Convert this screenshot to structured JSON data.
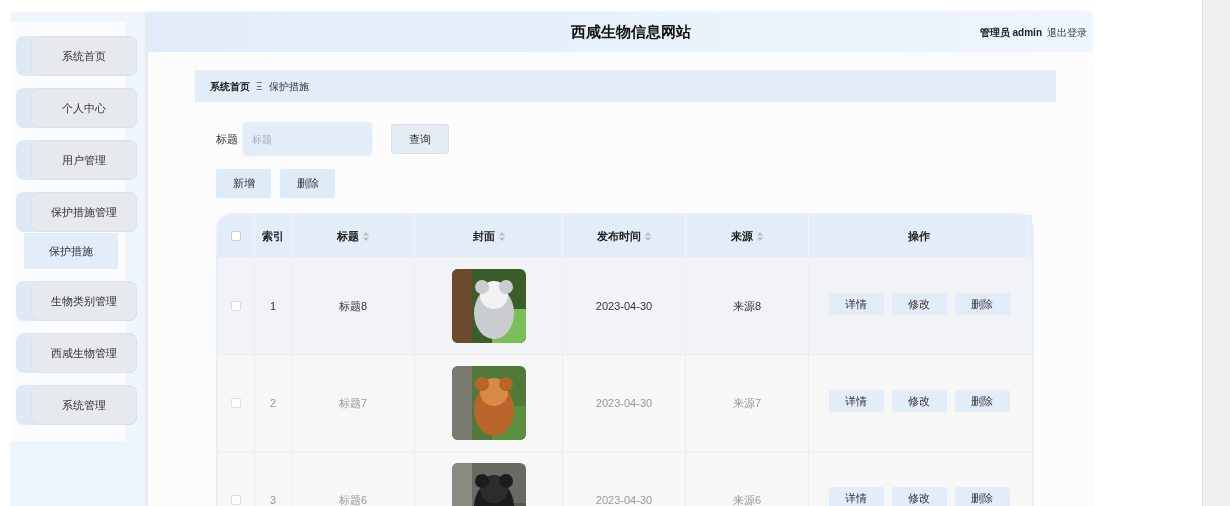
{
  "site_title": "西咸生物信息网站",
  "user": {
    "role": "管理员 admin",
    "logout": "退出登录"
  },
  "sidebar": {
    "items": [
      {
        "label": "系统首页"
      },
      {
        "label": "个人中心"
      },
      {
        "label": "用户管理"
      },
      {
        "label": "保护措施管理",
        "children": [
          {
            "label": "保护措施",
            "selected": true
          }
        ]
      },
      {
        "label": "生物类别管理"
      },
      {
        "label": "西咸生物管理"
      },
      {
        "label": "系统管理"
      }
    ]
  },
  "breadcrumb": {
    "home": "系统首页",
    "separator": "Ξ",
    "current": "保护措施"
  },
  "search": {
    "label": "标题",
    "placeholder": "标题",
    "button": "查询"
  },
  "actions": [
    "新增",
    "删除"
  ],
  "table": {
    "all_checked": false,
    "columns": [
      {
        "label": "索引",
        "sortable": false
      },
      {
        "label": "标题",
        "sortable": true
      },
      {
        "label": "封面",
        "sortable": true
      },
      {
        "label": "发布时间",
        "sortable": true
      },
      {
        "label": "来源",
        "sortable": true
      },
      {
        "label": "操作",
        "sortable": false
      }
    ],
    "rows": [
      {
        "index": "1",
        "title": "标题8",
        "date": "2023-04-30",
        "source": "来源8",
        "hovered": true,
        "checked": false,
        "buttons": [
          "详情",
          "修改",
          "删除"
        ]
      },
      {
        "index": "2",
        "title": "标题7",
        "date": "2023-04-30",
        "source": "来源7",
        "hovered": false,
        "checked": false,
        "buttons": [
          "详情",
          "修改",
          "删除"
        ]
      },
      {
        "index": "3",
        "title": "标题6",
        "date": "2023-04-30",
        "source": "来源6",
        "hovered": false,
        "checked": false,
        "buttons": [
          "详情",
          "修改",
          "删除"
        ]
      }
    ]
  }
}
